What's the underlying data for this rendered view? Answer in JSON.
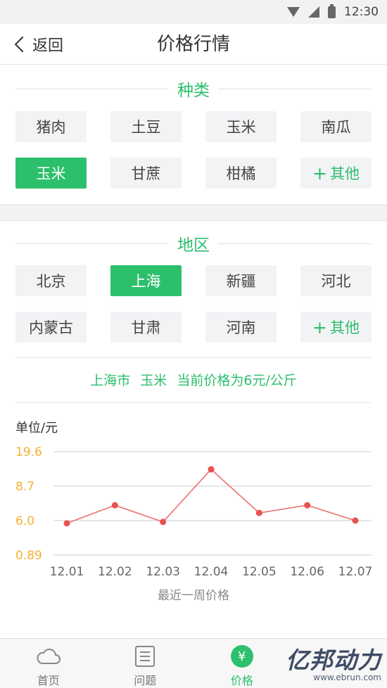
{
  "status_bar": {
    "time": "12:30"
  },
  "nav": {
    "back_label": "返回",
    "title": "价格行情"
  },
  "category_section": {
    "heading": "种类",
    "items": [
      "猪肉",
      "土豆",
      "玉米",
      "南瓜",
      "玉米",
      "甘蔗",
      "柑橘"
    ],
    "selected_index": 4,
    "other_label": "其他"
  },
  "region_section": {
    "heading": "地区",
    "items": [
      "北京",
      "上海",
      "新疆",
      "河北",
      "内蒙古",
      "甘肃",
      "河南"
    ],
    "selected_index": 1,
    "other_label": "其他"
  },
  "summary": {
    "city": "上海市",
    "crop": "玉米",
    "price_text": "当前价格为6元/公斤"
  },
  "chart_data": {
    "type": "line",
    "ylabel": "单位/元",
    "xlabel": "最近一周价格",
    "categories": [
      "12.01",
      "12.02",
      "12.03",
      "12.04",
      "12.05",
      "12.06",
      "12.07"
    ],
    "y_ticks": [
      "19.6",
      "8.7",
      "6.0",
      "0.89"
    ],
    "series": [
      {
        "values": [
          5.6,
          7.2,
          5.8,
          14.0,
          6.6,
          7.2,
          6.0
        ]
      }
    ],
    "colors": {
      "line": "#ee7070",
      "point": "#e85252",
      "tick": "#f2b233",
      "grid": "#cccccc"
    },
    "grid": true
  },
  "tab_bar": {
    "items": [
      {
        "label": "首页",
        "icon": "cloud-icon"
      },
      {
        "label": "问题",
        "icon": "list-icon"
      },
      {
        "label": "价格",
        "icon": "yen-icon"
      },
      {
        "label": "",
        "icon": ""
      }
    ],
    "active_index": 2
  },
  "watermark": {
    "main": "亿邦动力",
    "sub": "www.ebrun.com"
  },
  "colors": {
    "accent": "#2cc06c",
    "chip_bg": "#f2f3f5"
  }
}
